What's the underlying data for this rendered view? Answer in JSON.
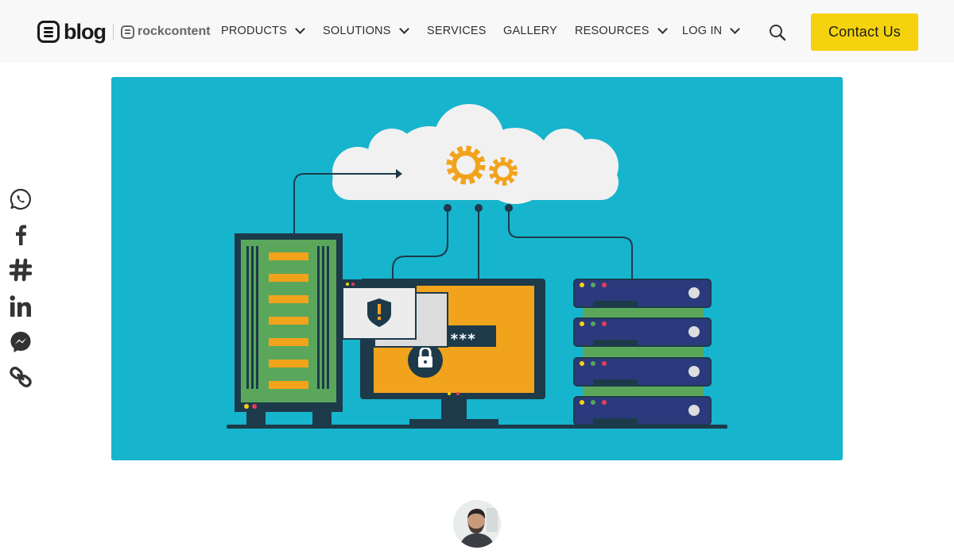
{
  "brand": {
    "blog_word": "blog",
    "partner_word": "rockcontent"
  },
  "nav": {
    "items": [
      {
        "label": "PRODUCTS",
        "has_dropdown": true
      },
      {
        "label": "SOLUTIONS",
        "has_dropdown": true
      },
      {
        "label": "SERVICES",
        "has_dropdown": false
      },
      {
        "label": "GALLERY",
        "has_dropdown": false
      },
      {
        "label": "RESOURCES",
        "has_dropdown": true
      },
      {
        "label": "LOG IN",
        "has_dropdown": true
      }
    ],
    "search_icon": "search-icon",
    "cta_label": "Contact Us",
    "cta_color": "#f5d20e"
  },
  "share": {
    "icons": [
      "whatsapp-icon",
      "facebook-icon",
      "slack-icon",
      "linkedin-icon",
      "messenger-icon",
      "link-icon"
    ]
  },
  "hero": {
    "background_color": "#17b4cd",
    "password_mask": "***"
  },
  "author": {
    "avatar_icon": "author-avatar"
  }
}
